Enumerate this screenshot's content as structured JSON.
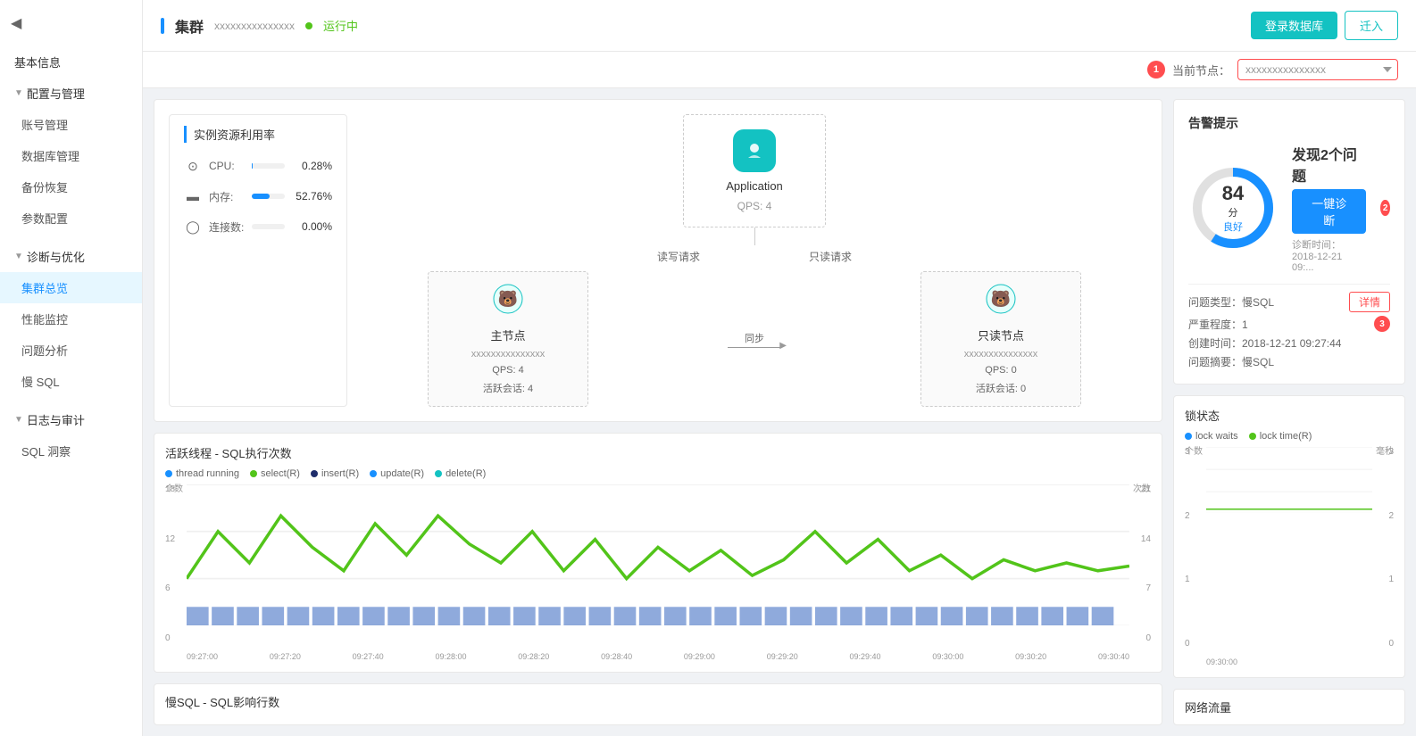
{
  "sidebar": {
    "toggle_icon": "◀",
    "basic_info": "基本信息",
    "config_management": "配置与管理",
    "config_management_arrow": "▼",
    "account_management": "账号管理",
    "database_management": "数据库管理",
    "backup_recovery": "备份恢复",
    "param_config": "参数配置",
    "diagnosis_optimization": "诊断与优化",
    "diagnosis_arrow": "▼",
    "cluster_overview": "集群总览",
    "performance_monitor": "性能监控",
    "issue_analysis": "问题分析",
    "slow_sql": "慢 SQL",
    "log_audit": "日志与审计",
    "log_arrow": "▼",
    "sql_insight": "SQL 洞察"
  },
  "header": {
    "title_bar_color": "#1890ff",
    "title": "集群",
    "subtitle": "xxxxxxxxxxxxxxx",
    "status_text": "运行中",
    "login_db_btn": "登录数据库",
    "enter_btn": "迁入"
  },
  "node_selector": {
    "label": "当前节点：",
    "placeholder": "xxxxxxxxxxxxxxx",
    "badge": "1"
  },
  "resource": {
    "title": "实例资源利用率",
    "cpu_label": "CPU:",
    "cpu_value": "0.28%",
    "cpu_percent": 0.28,
    "memory_label": "内存:",
    "memory_value": "52.76%",
    "memory_percent": 52.76,
    "connections_label": "连接数:",
    "connections_value": "0.00%",
    "connections_percent": 0
  },
  "topology": {
    "app_name": "Application",
    "app_qps": "QPS: 4",
    "read_write_label": "读写请求",
    "read_only_label": "只读请求",
    "master_node": {
      "title": "主节点",
      "ip": "xxxxxxxxxxxxxxx",
      "qps": "QPS: 4",
      "sessions": "活跃会话: 4"
    },
    "sync_label": "同步",
    "readonly_node": {
      "title": "只读节点",
      "ip": "xxxxxxxxxxxxxxx",
      "qps": "QPS: 0",
      "sessions": "活跃会话: 0"
    }
  },
  "charts": {
    "active_threads": {
      "title": "活跃线程 - SQL执行次数",
      "y_left_unit": "个数",
      "y_right_unit": "次数",
      "y_left_values": [
        "18",
        "12",
        "6",
        "0"
      ],
      "y_right_values": [
        "21",
        "14",
        "7",
        "0"
      ],
      "x_labels": [
        "09:27:00",
        "09:27:20",
        "09:27:40",
        "09:28:00",
        "09:28:20",
        "09:28:40",
        "09:29:00",
        "09:29:20",
        "09:29:40",
        "09:30:00",
        "09:30:20",
        "09:30:40"
      ],
      "legend": [
        {
          "label": "thread running",
          "color": "#1890ff"
        },
        {
          "label": "select(R)",
          "color": "#52c41a"
        },
        {
          "label": "insert(R)",
          "color": "#1e2d6b"
        },
        {
          "label": "update(R)",
          "color": "#1890ff"
        },
        {
          "label": "delete(R)",
          "color": "#13c2c2"
        }
      ]
    },
    "lock_state": {
      "title": "锁状态",
      "y_left_unit": "个数",
      "y_right_unit": "毫秒",
      "y_left_values": [
        "3",
        "2",
        "1",
        "0"
      ],
      "y_right_values": [
        "3",
        "2",
        "1",
        "0"
      ],
      "x_labels": [
        "09:30:00"
      ],
      "legend": [
        {
          "label": "lock waits",
          "color": "#1890ff"
        },
        {
          "label": "lock time(R)",
          "color": "#52c41a"
        }
      ]
    }
  },
  "alert": {
    "title": "告警提示",
    "score": "84",
    "score_unit": "分",
    "score_label": "良好",
    "issues_title": "发现2个问题",
    "diagnose_btn": "一键诊断",
    "diagnose_time_label": "诊断时间：",
    "diagnose_time": "2018-12-21 09:...",
    "issue_type_label": "问题类型：慢SQL",
    "severity_label": "严重程度：1",
    "create_time_label": "创建时间：2018-12-21 09:27:44",
    "issue_summary_label": "问题摘要：慢SQL",
    "detail_btn": "详情",
    "badge2": "2",
    "badge3": "3",
    "donut_color": "#1890ff",
    "donut_bg": "#e0e0e0"
  },
  "bottom_sections": {
    "slow_sql_title": "慢SQL - SQL影响行数",
    "network_title": "网络流量"
  }
}
